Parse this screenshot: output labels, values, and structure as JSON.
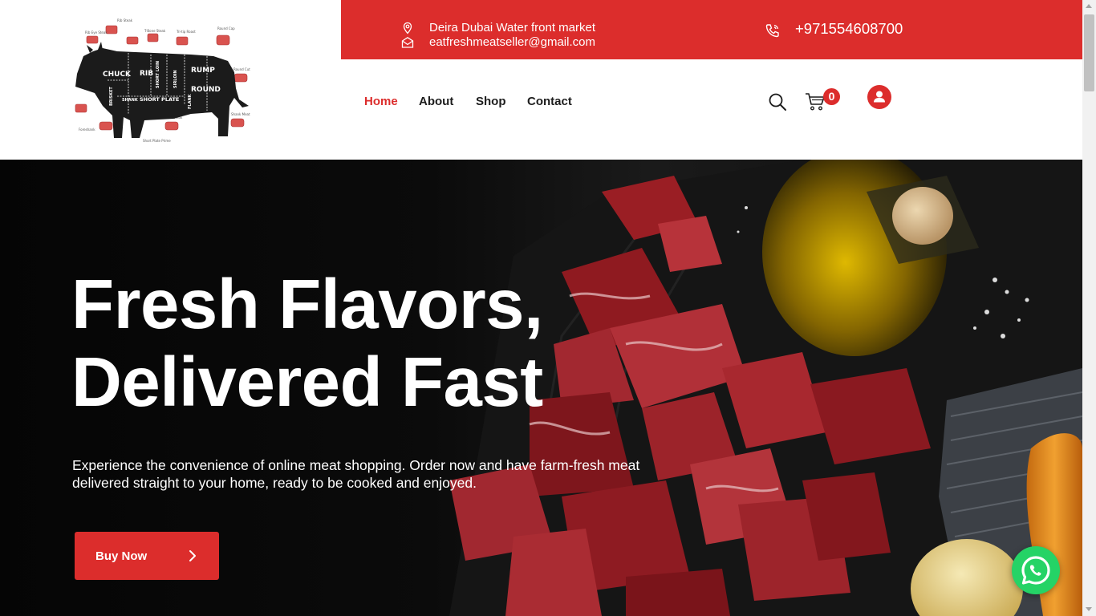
{
  "topbar": {
    "address": "Deira Dubai Water front market",
    "email": "eatfreshmeatseller@gmail.com",
    "phone": "+971554608700"
  },
  "logo": {
    "cuts": [
      "CHUCK",
      "RIB",
      "SHORT LOIN",
      "SIRLOIN",
      "RUMP",
      "ROUND",
      "BRISKET",
      "SHANK",
      "SHORT PLATE",
      "FLANK"
    ]
  },
  "nav": {
    "items": [
      {
        "label": "Home",
        "active": true
      },
      {
        "label": "About",
        "active": false
      },
      {
        "label": "Shop",
        "active": false
      },
      {
        "label": "Contact",
        "active": false
      }
    ]
  },
  "header_icons": {
    "search": "search-icon",
    "cart": "cart-icon",
    "cart_count": "0",
    "account": "user-icon"
  },
  "hero": {
    "title_line1": "Fresh Flavors,",
    "title_line2": "Delivered Fast",
    "description": "Experience the convenience of online meat shopping. Order now and have farm-fresh meat delivered straight to your home, ready to be cooked and enjoyed.",
    "cta_label": "Buy Now"
  },
  "colors": {
    "brand_red": "#dc2d2c",
    "whatsapp_green": "#25d366",
    "text_dark": "#1d1d1d"
  }
}
